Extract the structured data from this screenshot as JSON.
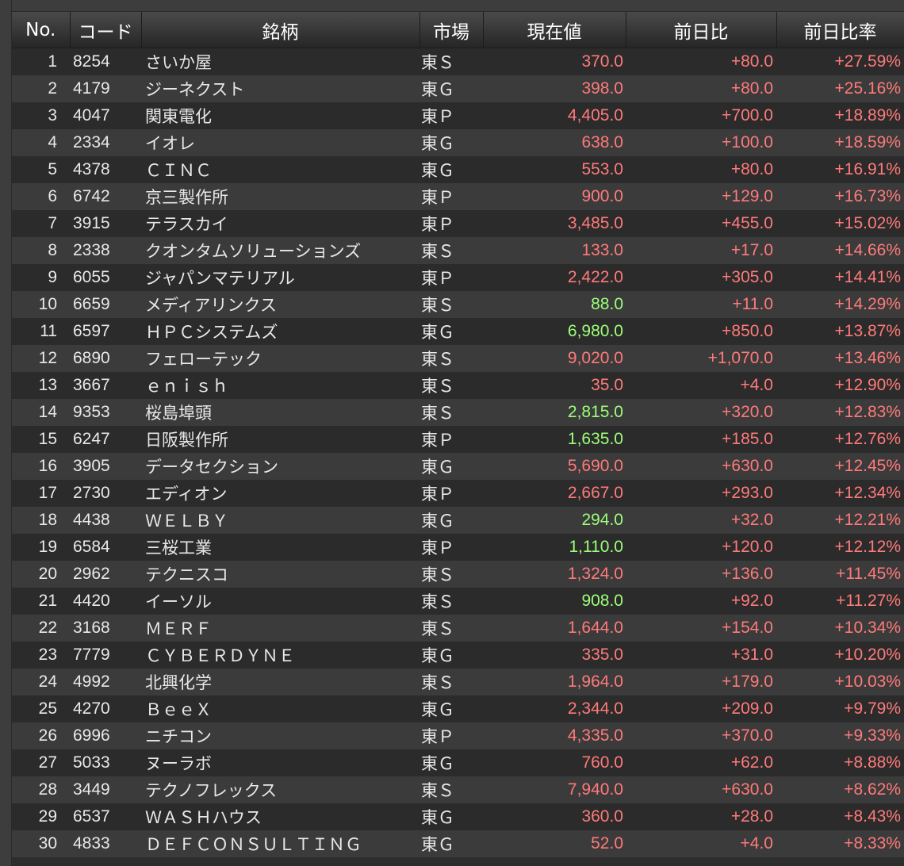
{
  "header": {
    "no": "No.",
    "code": "コード",
    "name": "銘柄",
    "market": "市場",
    "price": "現在値",
    "change": "前日比",
    "change_pct": "前日比率"
  },
  "colors": {
    "up": "#ff7a7a",
    "tick_up": "#9dff7a",
    "text": "#e8e8e8"
  },
  "rows": [
    {
      "no": "1",
      "code": "8254",
      "name": "さいか屋",
      "market": "東Ｓ",
      "price": "370.0",
      "price_color": "red",
      "change": "+80.0",
      "change_pct": "+27.59%"
    },
    {
      "no": "2",
      "code": "4179",
      "name": "ジーネクスト",
      "market": "東Ｇ",
      "price": "398.0",
      "price_color": "red",
      "change": "+80.0",
      "change_pct": "+25.16%"
    },
    {
      "no": "3",
      "code": "4047",
      "name": "関東電化",
      "market": "東Ｐ",
      "price": "4,405.0",
      "price_color": "red",
      "change": "+700.0",
      "change_pct": "+18.89%"
    },
    {
      "no": "4",
      "code": "2334",
      "name": "イオレ",
      "market": "東Ｇ",
      "price": "638.0",
      "price_color": "red",
      "change": "+100.0",
      "change_pct": "+18.59%"
    },
    {
      "no": "5",
      "code": "4378",
      "name": "ＣＩＮＣ",
      "market": "東Ｇ",
      "price": "553.0",
      "price_color": "red",
      "change": "+80.0",
      "change_pct": "+16.91%"
    },
    {
      "no": "6",
      "code": "6742",
      "name": "京三製作所",
      "market": "東Ｐ",
      "price": "900.0",
      "price_color": "red",
      "change": "+129.0",
      "change_pct": "+16.73%"
    },
    {
      "no": "7",
      "code": "3915",
      "name": "テラスカイ",
      "market": "東Ｐ",
      "price": "3,485.0",
      "price_color": "red",
      "change": "+455.0",
      "change_pct": "+15.02%"
    },
    {
      "no": "8",
      "code": "2338",
      "name": "クオンタムソリューションズ",
      "market": "東Ｓ",
      "price": "133.0",
      "price_color": "red",
      "change": "+17.0",
      "change_pct": "+14.66%"
    },
    {
      "no": "9",
      "code": "6055",
      "name": "ジャパンマテリアル",
      "market": "東Ｐ",
      "price": "2,422.0",
      "price_color": "red",
      "change": "+305.0",
      "change_pct": "+14.41%"
    },
    {
      "no": "10",
      "code": "6659",
      "name": "メディアリンクス",
      "market": "東Ｓ",
      "price": "88.0",
      "price_color": "green",
      "change": "+11.0",
      "change_pct": "+14.29%"
    },
    {
      "no": "11",
      "code": "6597",
      "name": "ＨＰＣシステムズ",
      "market": "東Ｇ",
      "price": "6,980.0",
      "price_color": "green",
      "change": "+850.0",
      "change_pct": "+13.87%"
    },
    {
      "no": "12",
      "code": "6890",
      "name": "フェローテック",
      "market": "東Ｓ",
      "price": "9,020.0",
      "price_color": "red",
      "change": "+1,070.0",
      "change_pct": "+13.46%"
    },
    {
      "no": "13",
      "code": "3667",
      "name": "ｅｎｉｓｈ",
      "market": "東Ｓ",
      "price": "35.0",
      "price_color": "red",
      "change": "+4.0",
      "change_pct": "+12.90%"
    },
    {
      "no": "14",
      "code": "9353",
      "name": "桜島埠頭",
      "market": "東Ｓ",
      "price": "2,815.0",
      "price_color": "green",
      "change": "+320.0",
      "change_pct": "+12.83%"
    },
    {
      "no": "15",
      "code": "6247",
      "name": "日阪製作所",
      "market": "東Ｐ",
      "price": "1,635.0",
      "price_color": "green",
      "change": "+185.0",
      "change_pct": "+12.76%"
    },
    {
      "no": "16",
      "code": "3905",
      "name": "データセクション",
      "market": "東Ｇ",
      "price": "5,690.0",
      "price_color": "red",
      "change": "+630.0",
      "change_pct": "+12.45%"
    },
    {
      "no": "17",
      "code": "2730",
      "name": "エディオン",
      "market": "東Ｐ",
      "price": "2,667.0",
      "price_color": "red",
      "change": "+293.0",
      "change_pct": "+12.34%"
    },
    {
      "no": "18",
      "code": "4438",
      "name": "ＷＥＬＢＹ",
      "market": "東Ｇ",
      "price": "294.0",
      "price_color": "green",
      "change": "+32.0",
      "change_pct": "+12.21%"
    },
    {
      "no": "19",
      "code": "6584",
      "name": "三桜工業",
      "market": "東Ｐ",
      "price": "1,110.0",
      "price_color": "green",
      "change": "+120.0",
      "change_pct": "+12.12%"
    },
    {
      "no": "20",
      "code": "2962",
      "name": "テクニスコ",
      "market": "東Ｓ",
      "price": "1,324.0",
      "price_color": "red",
      "change": "+136.0",
      "change_pct": "+11.45%"
    },
    {
      "no": "21",
      "code": "4420",
      "name": "イーソル",
      "market": "東Ｓ",
      "price": "908.0",
      "price_color": "green",
      "change": "+92.0",
      "change_pct": "+11.27%"
    },
    {
      "no": "22",
      "code": "3168",
      "name": "ＭＥＲＦ",
      "market": "東Ｓ",
      "price": "1,644.0",
      "price_color": "red",
      "change": "+154.0",
      "change_pct": "+10.34%"
    },
    {
      "no": "23",
      "code": "7779",
      "name": "ＣＹＢＥＲＤＹＮＥ",
      "market": "東Ｇ",
      "price": "335.0",
      "price_color": "red",
      "change": "+31.0",
      "change_pct": "+10.20%"
    },
    {
      "no": "24",
      "code": "4992",
      "name": "北興化学",
      "market": "東Ｓ",
      "price": "1,964.0",
      "price_color": "red",
      "change": "+179.0",
      "change_pct": "+10.03%"
    },
    {
      "no": "25",
      "code": "4270",
      "name": "ＢｅｅＸ",
      "market": "東Ｇ",
      "price": "2,344.0",
      "price_color": "red",
      "change": "+209.0",
      "change_pct": "+9.79%"
    },
    {
      "no": "26",
      "code": "6996",
      "name": "ニチコン",
      "market": "東Ｐ",
      "price": "4,335.0",
      "price_color": "red",
      "change": "+370.0",
      "change_pct": "+9.33%"
    },
    {
      "no": "27",
      "code": "5033",
      "name": "ヌーラボ",
      "market": "東Ｇ",
      "price": "760.0",
      "price_color": "red",
      "change": "+62.0",
      "change_pct": "+8.88%"
    },
    {
      "no": "28",
      "code": "3449",
      "name": "テクノフレックス",
      "market": "東Ｓ",
      "price": "7,940.0",
      "price_color": "red",
      "change": "+630.0",
      "change_pct": "+8.62%"
    },
    {
      "no": "29",
      "code": "6537",
      "name": "ＷＡＳＨハウス",
      "market": "東Ｇ",
      "price": "360.0",
      "price_color": "red",
      "change": "+28.0",
      "change_pct": "+8.43%"
    },
    {
      "no": "30",
      "code": "4833",
      "name": "ＤＥＦＣＯＮＳＵＬＴＩＮＧ",
      "market": "東Ｇ",
      "price": "52.0",
      "price_color": "red",
      "change": "+4.0",
      "change_pct": "+8.33%"
    }
  ]
}
